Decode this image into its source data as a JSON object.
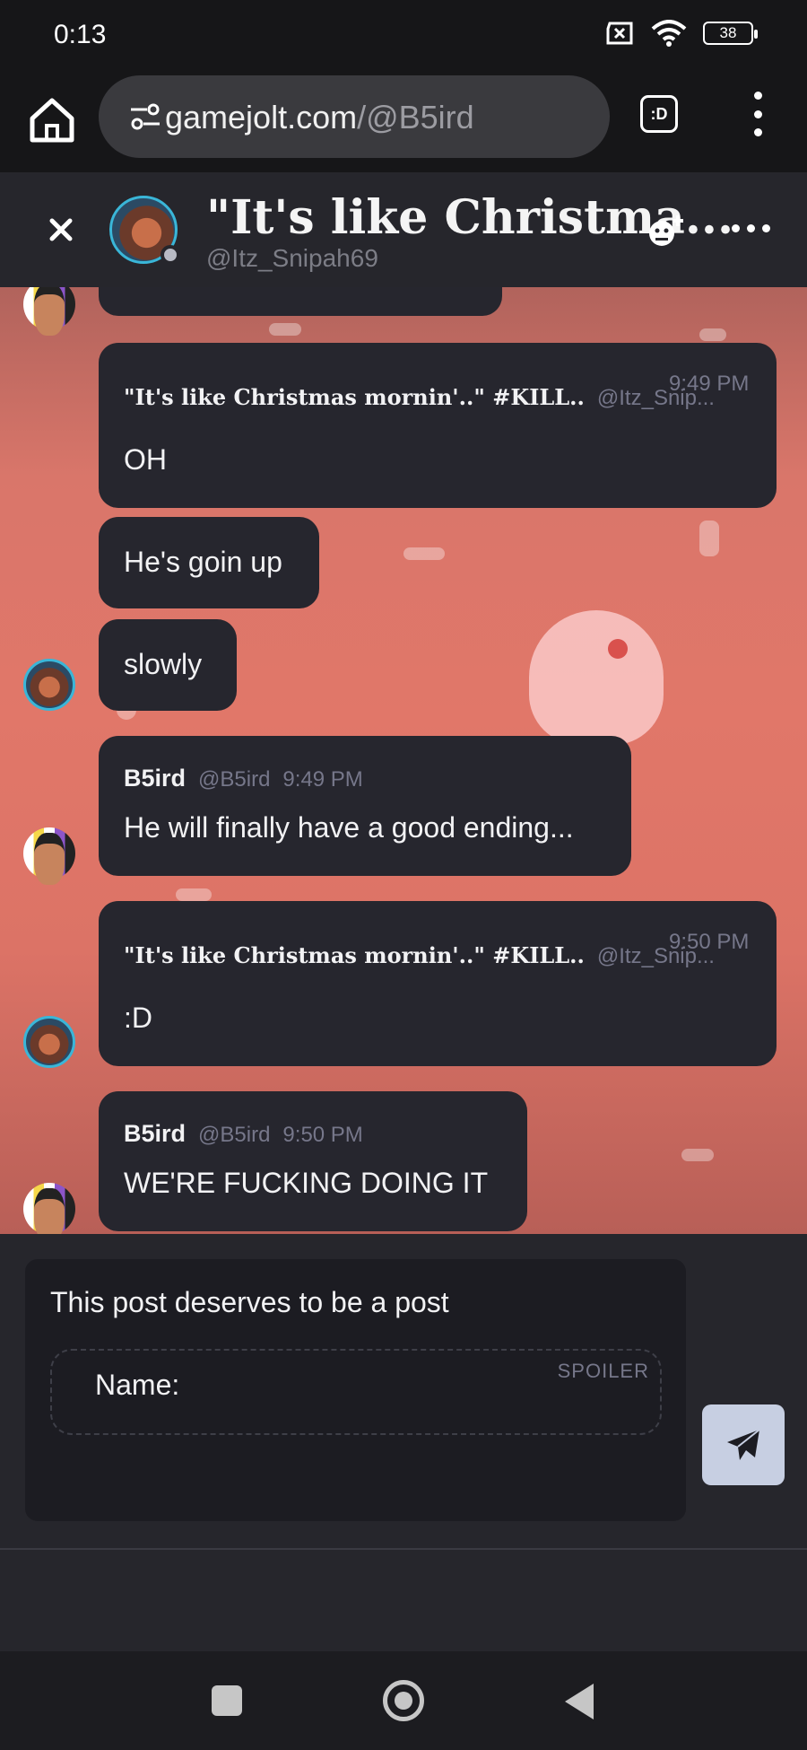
{
  "status_bar": {
    "time": "0:13",
    "battery": "38"
  },
  "browser": {
    "domain": "gamejolt.com",
    "path": "/@B5ird",
    "tab_switcher_label": ":D"
  },
  "chat_header": {
    "title": "\"It's like Christma...",
    "subtitle": "@Itz_Snipah69"
  },
  "messages": [
    {
      "author": "\"It's like Christmas mornin'..\" #KILL..",
      "handle": "@Itz_Snip...",
      "time": "9:49 PM",
      "text": "OH"
    },
    {
      "text": "He's goin up"
    },
    {
      "text": "slowly"
    },
    {
      "author": "B5ird",
      "handle": "@B5ird",
      "time": "9:49 PM",
      "text": "He will finally have a good ending..."
    },
    {
      "author": "\"It's like Christmas mornin'..\" #KILL..",
      "handle": "@Itz_Snip...",
      "time": "9:50 PM",
      "text": ":D"
    },
    {
      "author": "B5ird",
      "handle": "@B5ird",
      "time": "9:50 PM",
      "text": "WE'RE FUCKING DOING IT"
    }
  ],
  "composer": {
    "text": "This post deserves to be a post",
    "spoiler_label": "SPOILER",
    "spoiler_text": "Name:"
  },
  "colors": {
    "accent_ring": "#3ab6d8",
    "bubble_bg": "#26262e",
    "send_button": "#c7cfe2"
  },
  "icons": [
    "home-icon",
    "tune-icon",
    "kebab-menu-icon",
    "close-icon",
    "add-friend-icon",
    "more-icon",
    "send-icon"
  ]
}
